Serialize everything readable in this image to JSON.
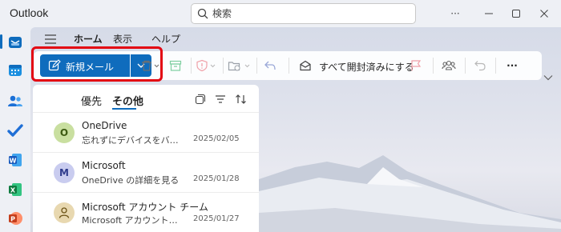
{
  "app": {
    "title": "Outlook"
  },
  "search": {
    "placeholder": "検索"
  },
  "window_controls": {
    "more": "···"
  },
  "ribbon": {
    "tabs": [
      {
        "label": "ホーム",
        "active": true
      },
      {
        "label": "表示",
        "active": false
      },
      {
        "label": "ヘルプ",
        "active": false
      }
    ],
    "new_mail_label": "新規メール",
    "mark_all_read_label": "すべて開封済みにする",
    "more_label": "···"
  },
  "list": {
    "tabs": [
      {
        "label": "優先",
        "active": false
      },
      {
        "label": "その他",
        "active": true
      }
    ],
    "messages": [
      {
        "initial": "O",
        "sender": "OneDrive",
        "preview": "忘れずにデバイスをバックアップ",
        "date": "2025/02/05",
        "avatar_bg": "#c9dfa0",
        "avatar_fg": "#3d5a12"
      },
      {
        "initial": "M",
        "sender": "Microsoft",
        "preview": "OneDrive の詳細を見る",
        "date": "2025/01/28",
        "avatar_bg": "#c9ccef",
        "avatar_fg": "#2e3a8c"
      },
      {
        "initial": "",
        "sender": "Microsoft アカウント チーム",
        "preview": "Microsoft アカウントのセキュリティ",
        "date": "2025/01/27",
        "avatar_bg": "#e8d8b0",
        "avatar_fg": "#6b5316",
        "avatar_icon": "person-icon"
      }
    ]
  },
  "colors": {
    "accent": "#0f6cbd",
    "highlight": "#e30613"
  }
}
